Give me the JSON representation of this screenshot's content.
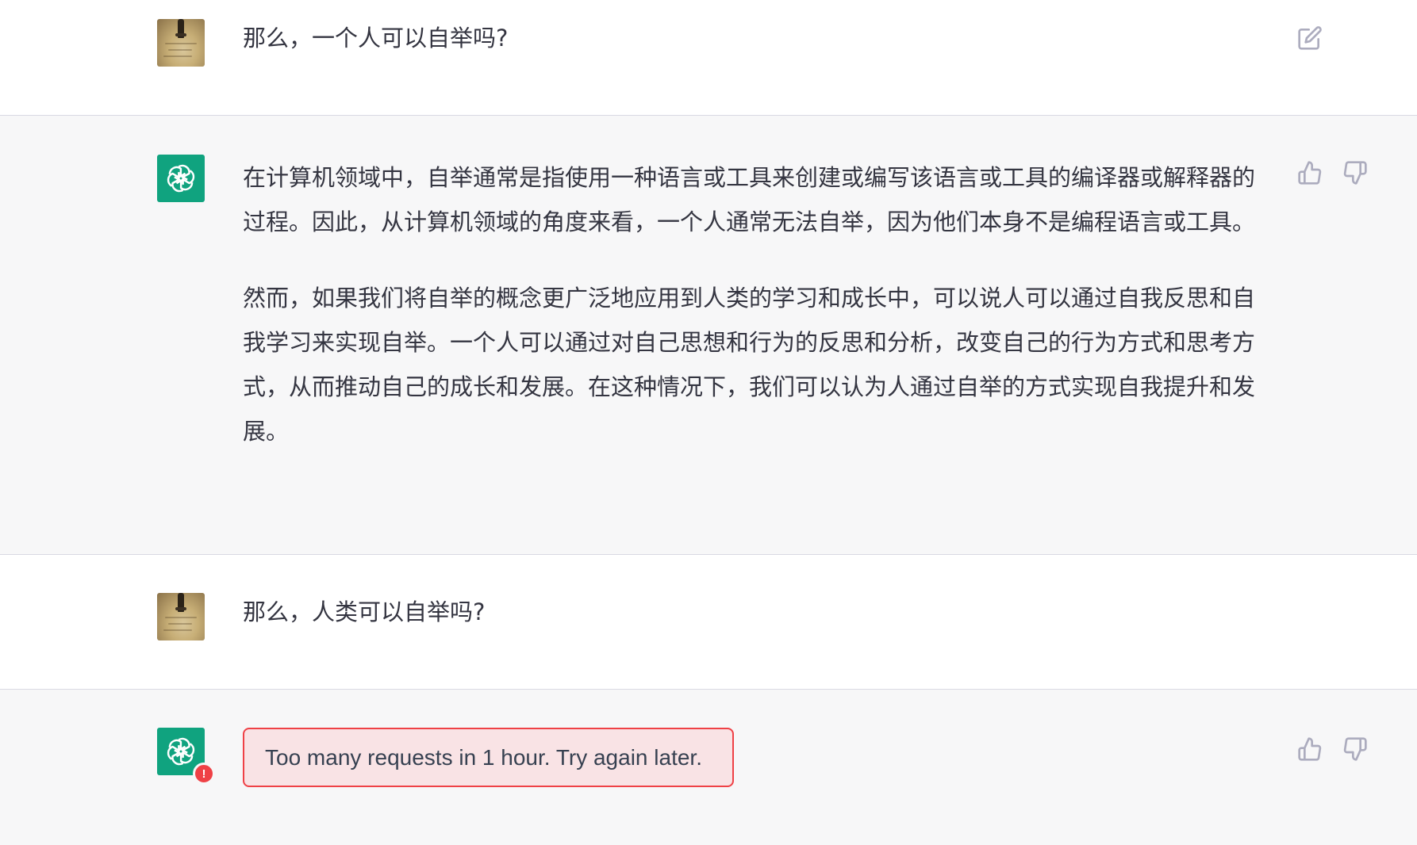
{
  "conversation": [
    {
      "role": "user",
      "avatar": "user-photo",
      "text": "那么，一个人可以自举吗?",
      "action_icon": "edit-icon"
    },
    {
      "role": "assistant",
      "avatar": "openai-logo-icon",
      "paragraphs": [
        "在计算机领域中，自举通常是指使用一种语言或工具来创建或编写该语言或工具的编译器或解释器的过程。因此，从计算机领域的角度来看，一个人通常无法自举，因为他们本身不是编程语言或工具。",
        "然而，如果我们将自举的概念更广泛地应用到人类的学习和成长中，可以说人可以通过自我反思和自我学习来实现自举。一个人可以通过对自己思想和行为的反思和分析，改变自己的行为方式和思考方式，从而推动自己的成长和发展。在这种情况下，我们可以认为人通过自举的方式实现自我提升和发展。"
      ],
      "action_icons": [
        "thumbs-up-icon",
        "thumbs-down-icon"
      ]
    },
    {
      "role": "user",
      "avatar": "user-photo",
      "text": "那么，人类可以自举吗?"
    },
    {
      "role": "assistant",
      "avatar": "openai-logo-icon",
      "error_badge": "!",
      "error_text": "Too many requests in 1 hour. Try again later.",
      "action_icons": [
        "thumbs-up-icon",
        "thumbs-down-icon"
      ]
    }
  ],
  "colors": {
    "assistant_bg": "#f7f7f8",
    "brand_green": "#10a37f",
    "error_red": "#ef4146",
    "error_bg": "#f9e3e5",
    "icon_gray": "#acacbe"
  }
}
